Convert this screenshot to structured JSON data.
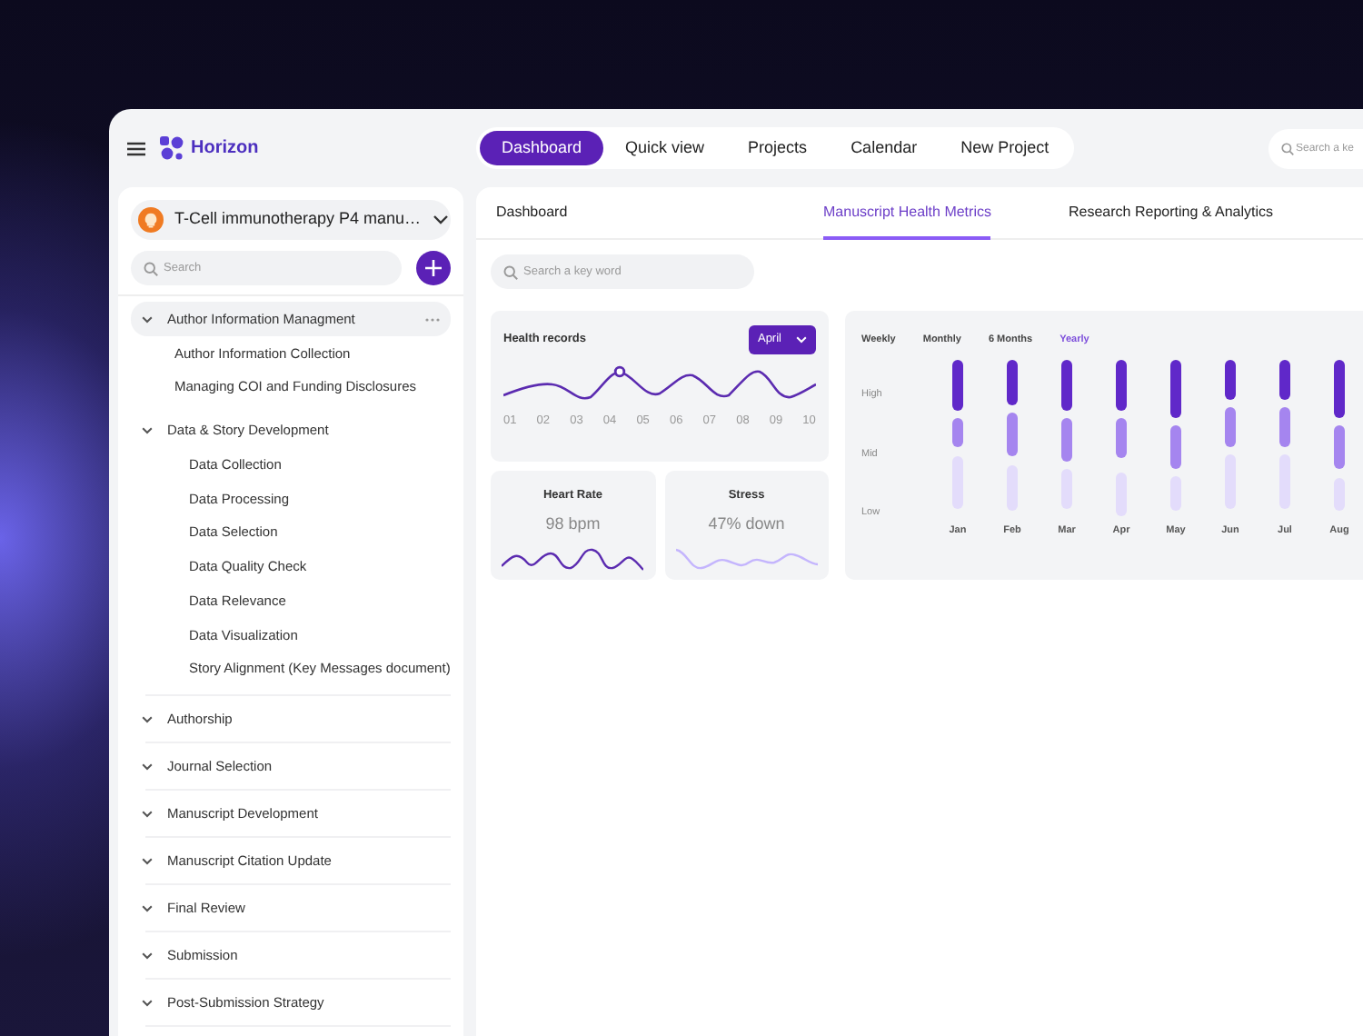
{
  "app": {
    "name": "Horizon"
  },
  "nav": [
    {
      "label": "Dashboard",
      "selected": true
    },
    {
      "label": "Quick view",
      "selected": false
    },
    {
      "label": "Projects",
      "selected": false
    },
    {
      "label": "Calendar",
      "selected": false
    },
    {
      "label": "New Project",
      "selected": false
    }
  ],
  "top_search": {
    "placeholder": "Search a ke"
  },
  "sidebar": {
    "project": "T-Cell immunotherapy P4 manu…",
    "search": {
      "placeholder": "Search"
    },
    "tree": [
      {
        "label": "Author Information Managment",
        "selected": true,
        "children": [
          {
            "label": "Author Information Collection"
          },
          {
            "label": "Managing COI and Funding Disclosures"
          }
        ]
      },
      {
        "label": "Data & Story Development",
        "selected": false,
        "children": [
          {
            "label": "Data Collection"
          },
          {
            "label": "Data Processing"
          },
          {
            "label": "Data Selection"
          },
          {
            "label": "Data Quality Check"
          },
          {
            "label": "Data Relevance"
          },
          {
            "label": "Data Visualization"
          },
          {
            "label": "Story Alignment (Key Messages document)"
          }
        ]
      },
      {
        "label": "Authorship",
        "selected": false
      },
      {
        "label": "Journal Selection",
        "selected": false
      },
      {
        "label": "Manuscript Development",
        "selected": false
      },
      {
        "label": "Manuscript Citation Update",
        "selected": false
      },
      {
        "label": "Final Review",
        "selected": false
      },
      {
        "label": "Submission",
        "selected": false
      },
      {
        "label": "Post-Submission Strategy",
        "selected": false
      }
    ]
  },
  "tabs": [
    {
      "label": "Dashboard",
      "selected": false
    },
    {
      "label": "Manuscript Health Metrics",
      "selected": true
    },
    {
      "label": "Research Reporting & Analytics",
      "selected": false
    }
  ],
  "search": {
    "placeholder": "Search a key word"
  },
  "health_records": {
    "title": "Health records",
    "month": "April",
    "x_labels": [
      "01",
      "02",
      "03",
      "04",
      "05",
      "06",
      "07",
      "08",
      "09",
      "10"
    ]
  },
  "heart_rate": {
    "title": "Heart Rate",
    "value": "98 bpm"
  },
  "stress": {
    "title": "Stress",
    "value": "47% down"
  },
  "activity": {
    "periods": [
      {
        "label": "Weekly",
        "selected": false
      },
      {
        "label": "Monthly",
        "selected": false
      },
      {
        "label": "6 Months",
        "selected": false
      },
      {
        "label": "Yearly",
        "selected": true
      }
    ],
    "levels": [
      "High",
      "Mid",
      "Low"
    ],
    "months": [
      "Jan",
      "Feb",
      "Mar",
      "Apr",
      "May",
      "Jun",
      "Jul",
      "Aug"
    ]
  }
}
